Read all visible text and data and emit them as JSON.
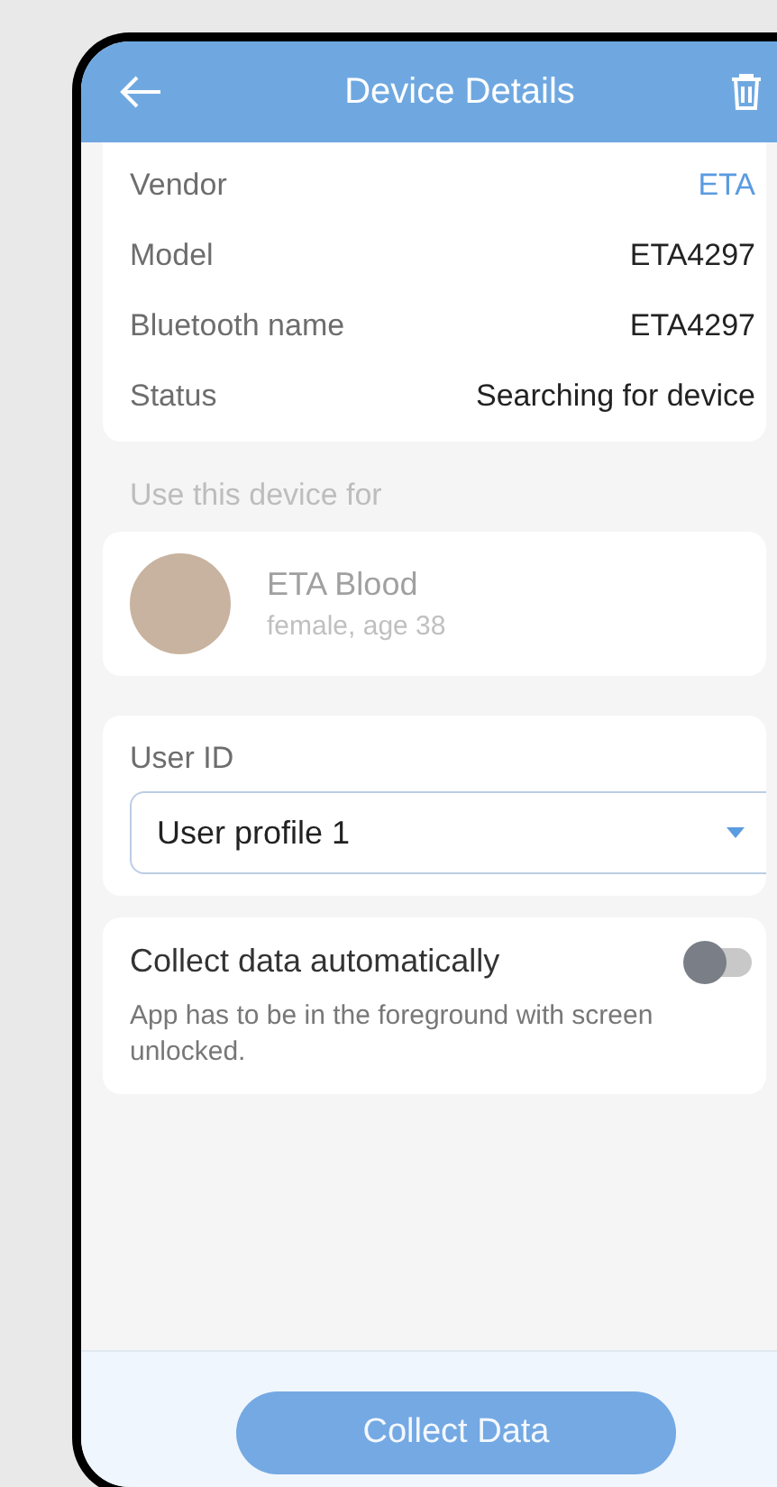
{
  "header": {
    "title": "Device Details"
  },
  "details": [
    {
      "label": "Vendor",
      "value": "ETA",
      "kind": "link"
    },
    {
      "label": "Model",
      "value": "ETA4297",
      "kind": "text"
    },
    {
      "label": "Bluetooth name",
      "value": "ETA4297",
      "kind": "text"
    },
    {
      "label": "Status",
      "value": "Searching for device",
      "kind": "text"
    }
  ],
  "usage": {
    "section_label": "Use this device for",
    "profile": {
      "name": "ETA Blood",
      "subtitle": "female, age 38"
    }
  },
  "user_id": {
    "label": "User ID",
    "value": "User profile 1"
  },
  "auto_collect": {
    "title": "Collect data automatically",
    "description": "App has to be in the foreground with screen unlocked.",
    "on": false
  },
  "action_button": "Collect Data"
}
